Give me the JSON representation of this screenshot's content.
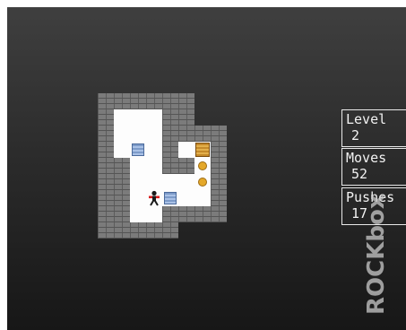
{
  "hud": {
    "level_label": "Level",
    "level_value": "2",
    "moves_label": "Moves",
    "moves_value": "52",
    "pushes_label": "Pushes",
    "pushes_value": "17"
  },
  "logo_text": "ROCKbox",
  "map": [
    "WWWWWW  ",
    "W___WW  ",
    "W___WWWW",
    "W_B_W_$W",
    "WW__WW.W",
    "WW____.W",
    "WW_PB__W",
    "WW__WWWW",
    "WWWWW   "
  ],
  "legend": {
    "W": "wall",
    "_": "floor",
    "B": "box",
    "$": "box-on-goal",
    ".": "goal",
    "P": "player"
  },
  "colors": {
    "wall": "#7b7b7b",
    "floor": "#fdfdfd",
    "box": "#a9c1e6",
    "goal": "#e4a82a",
    "player_shirt": "#d81e1e"
  }
}
